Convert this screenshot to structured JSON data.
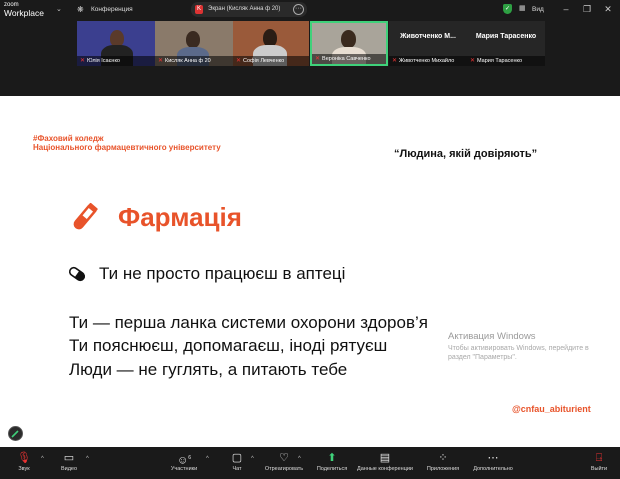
{
  "topbar": {
    "logo_line1": "zoom",
    "logo_line2": "Workplace",
    "conference_label": "Конференция",
    "screen_label": "Экран (Кисляк Анна ф 20)",
    "screen_flag": "K",
    "view_label": "Вид"
  },
  "participants": [
    {
      "name": "Юлія Ісаєнко",
      "muted": true
    },
    {
      "name": "Кисляк Анна ф 20",
      "muted": true
    },
    {
      "name": "Софія Левченко",
      "muted": true
    },
    {
      "name": "Вероніка Савченко",
      "muted": true,
      "active": true
    },
    {
      "name": "Животченко Михайло",
      "muted": true,
      "display": "Животченко  М..."
    },
    {
      "name": "Мария Тарасенко",
      "muted": true,
      "display": "Мария Тарасенко"
    }
  ],
  "slide": {
    "college_line1": "#Фаховий коледж",
    "college_line2": "Національного фармацевтичного університету",
    "motto": "“Людина, якій довіряють”",
    "title": "Фармація",
    "line1": "Ти не просто працюєш в аптеці",
    "line2": "Ти — перша ланка системи охорони здоров’я",
    "line3": "Ти пояснюєш, допомагаєш, іноді рятуєш",
    "line4": "Люди — не гуглять, а питають тебе",
    "handle": "@cnfau_abiturient",
    "accent_color": "#e8532a"
  },
  "activation": {
    "title": "Активация Windows",
    "body": "Чтобы активировать Windows, перейдите в раздел \"Параметры\"."
  },
  "toolbar": {
    "audio": "Звук",
    "video": "Видео",
    "participants": "Участники",
    "participants_count": "6",
    "chat": "Чат",
    "react": "Отреагировать",
    "share": "Поделиться",
    "conf_data": "Данные конференции",
    "apps": "Приложения",
    "more": "Дополнительно",
    "leave": "Выйти"
  }
}
